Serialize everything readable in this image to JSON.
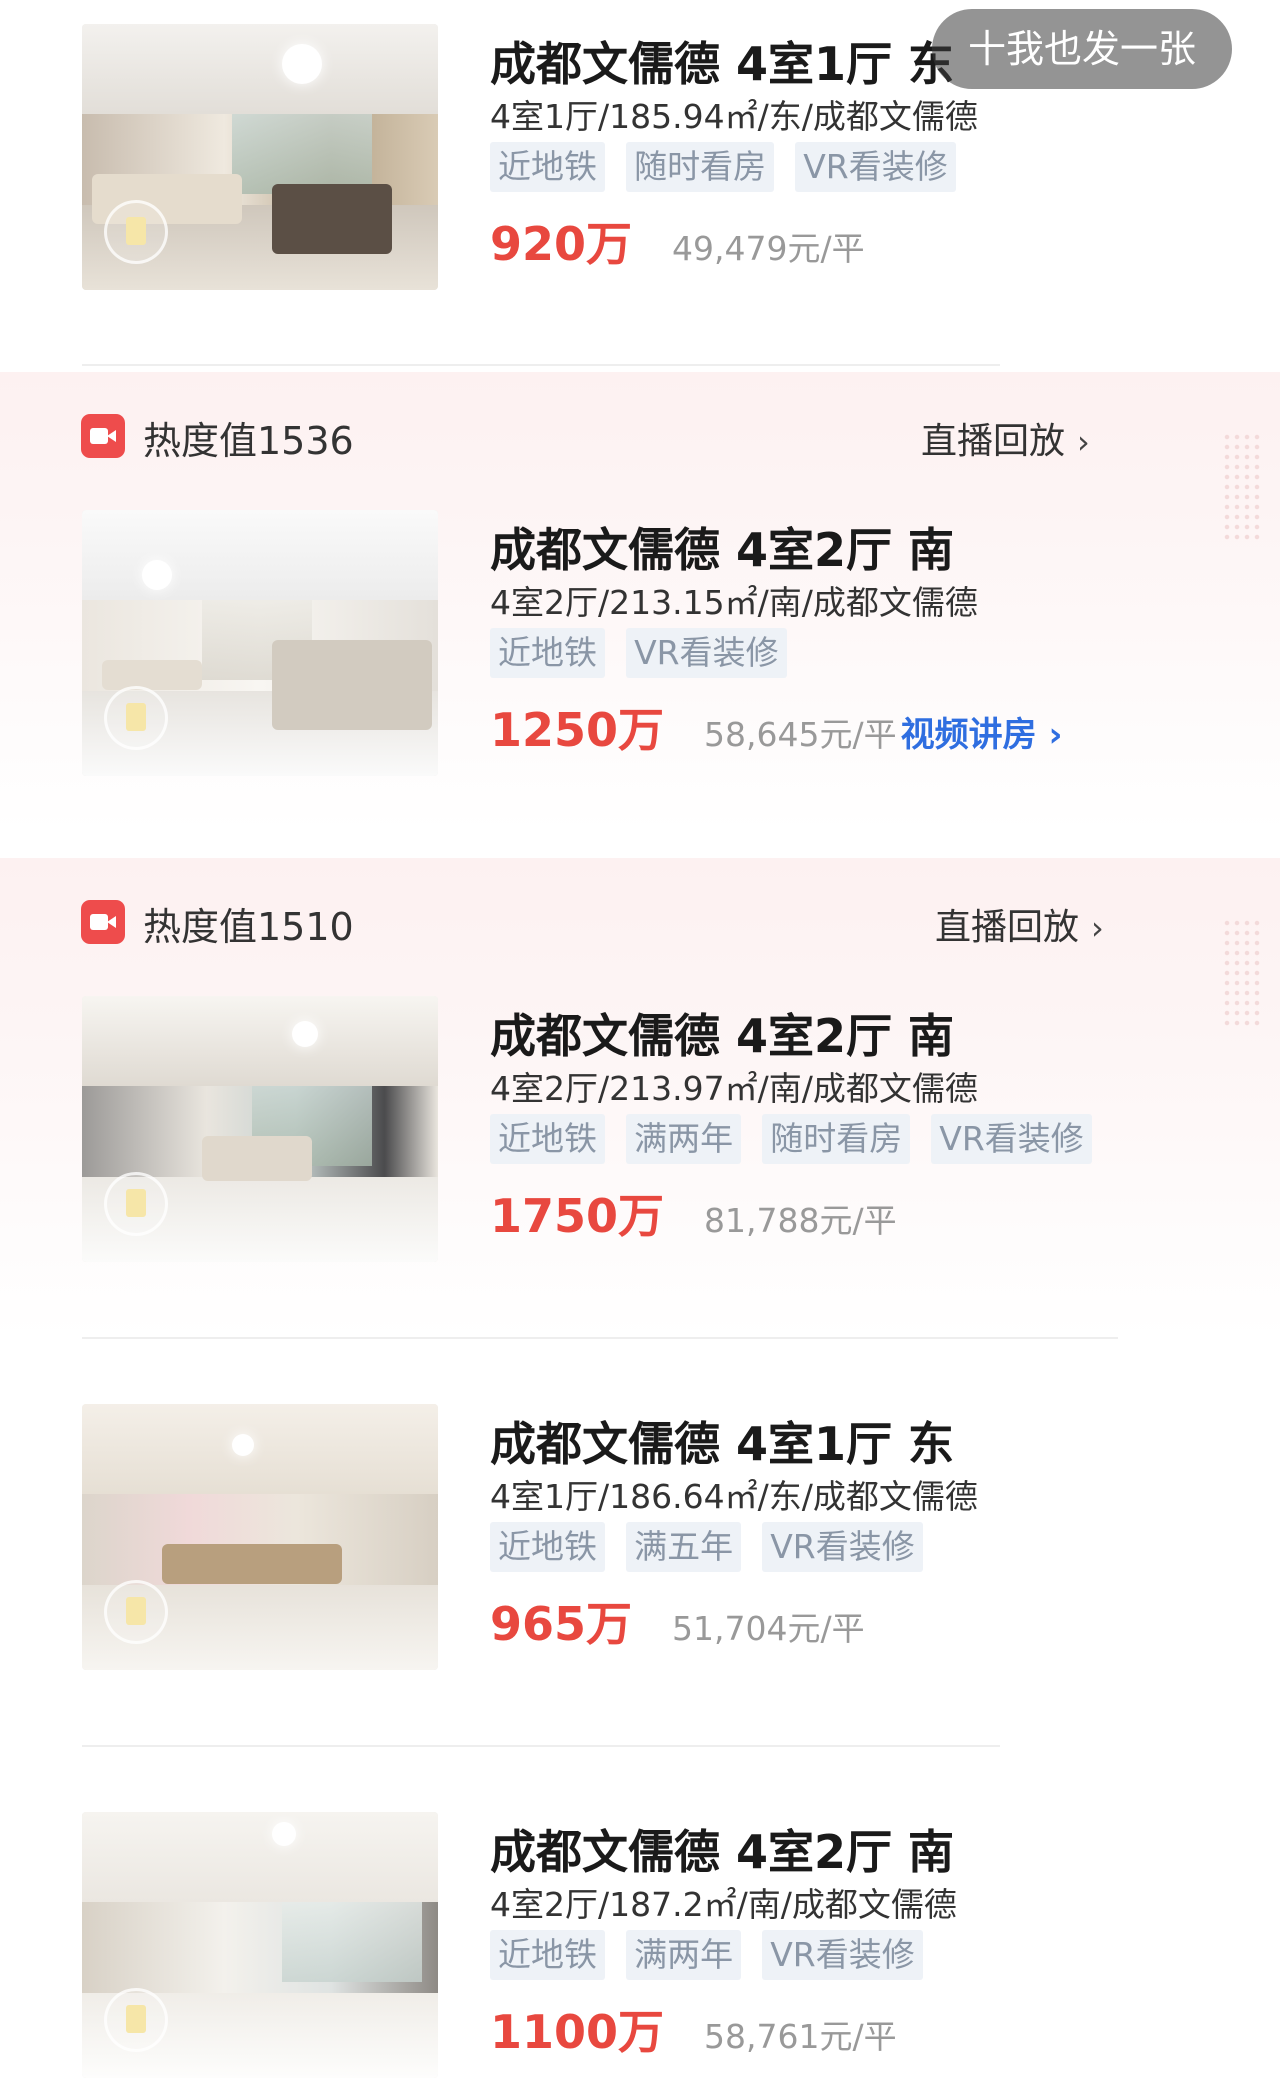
{
  "top_bar": {
    "post_button_label": "十我也发一张"
  },
  "live_rows": [
    {
      "heat": "热度值1536",
      "replay": "直播回放",
      "chev": "›"
    },
    {
      "heat": "热度值1510",
      "replay": "直播回放",
      "chev": "›"
    }
  ],
  "listings": [
    {
      "title": "成都文儒德 4室1厅 东",
      "subtitle": "4室1厅/185.94㎡/东/成都文儒德",
      "tags": [
        "近地铁",
        "随时看房",
        "VR看装修"
      ],
      "price": "920万",
      "unit_price": "49,479元/平"
    },
    {
      "title": "成都文儒德 4室2厅 南",
      "subtitle": "4室2厅/213.15㎡/南/成都文儒德",
      "tags": [
        "近地铁",
        "VR看装修"
      ],
      "price": "1250万",
      "unit_price": "58,645元/平",
      "video_link": "视频讲房 ›"
    },
    {
      "title": "成都文儒德 4室2厅 南",
      "subtitle": "4室2厅/213.97㎡/南/成都文儒德",
      "tags": [
        "近地铁",
        "满两年",
        "随时看房",
        "VR看装修"
      ],
      "price": "1750万",
      "unit_price": "81,788元/平"
    },
    {
      "title": "成都文儒德 4室1厅 东",
      "subtitle": "4室1厅/186.64㎡/东/成都文儒德",
      "tags": [
        "近地铁",
        "满五年",
        "VR看装修"
      ],
      "price": "965万",
      "unit_price": "51,704元/平"
    },
    {
      "title": "成都文儒德 4室2厅 南",
      "subtitle": "4室2厅/187.2㎡/南/成都文儒德",
      "tags": [
        "近地铁",
        "满两年",
        "VR看装修"
      ],
      "price": "1100万",
      "unit_price": "58,761元/平"
    }
  ],
  "colors": {
    "price": "#e8483f",
    "link": "#2f6ee0",
    "live_icon": "#ee4c4c",
    "tag_bg": "#eef2f7",
    "tag_text": "#8a96a6"
  }
}
